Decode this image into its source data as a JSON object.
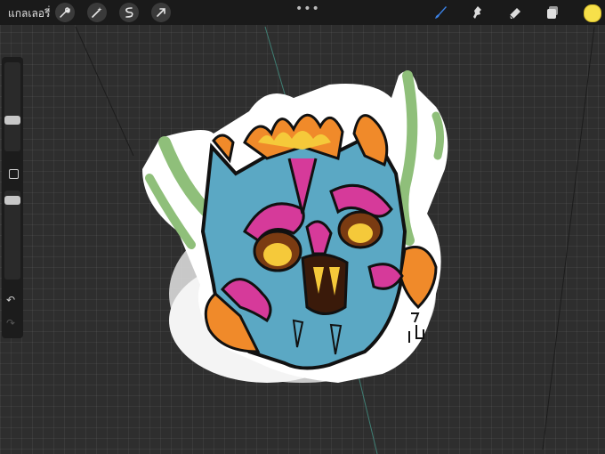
{
  "topbar": {
    "gallery_label": "แกลเลอรี่",
    "more_label": "•••"
  },
  "tools_left": [
    "wrench-icon",
    "magic-wand-icon",
    "selection-icon",
    "transform-arrow-icon"
  ],
  "tools_right": [
    "brush-icon",
    "smudge-icon",
    "eraser-icon",
    "layers-icon"
  ],
  "color": {
    "current": "#f7e04a"
  },
  "sidebar": {
    "brush_size_level": 0.55,
    "opacity_level": 0.1
  },
  "canvas": {
    "background": "#2e2e2e",
    "artwork": "neo-traditional skull sticker with flames and horns"
  },
  "colors": {
    "skull": "#5ba8c4",
    "magenta": "#d63a9a",
    "orange": "#f08a2a",
    "yellow": "#f5c93a",
    "green": "#8fbf7a"
  }
}
